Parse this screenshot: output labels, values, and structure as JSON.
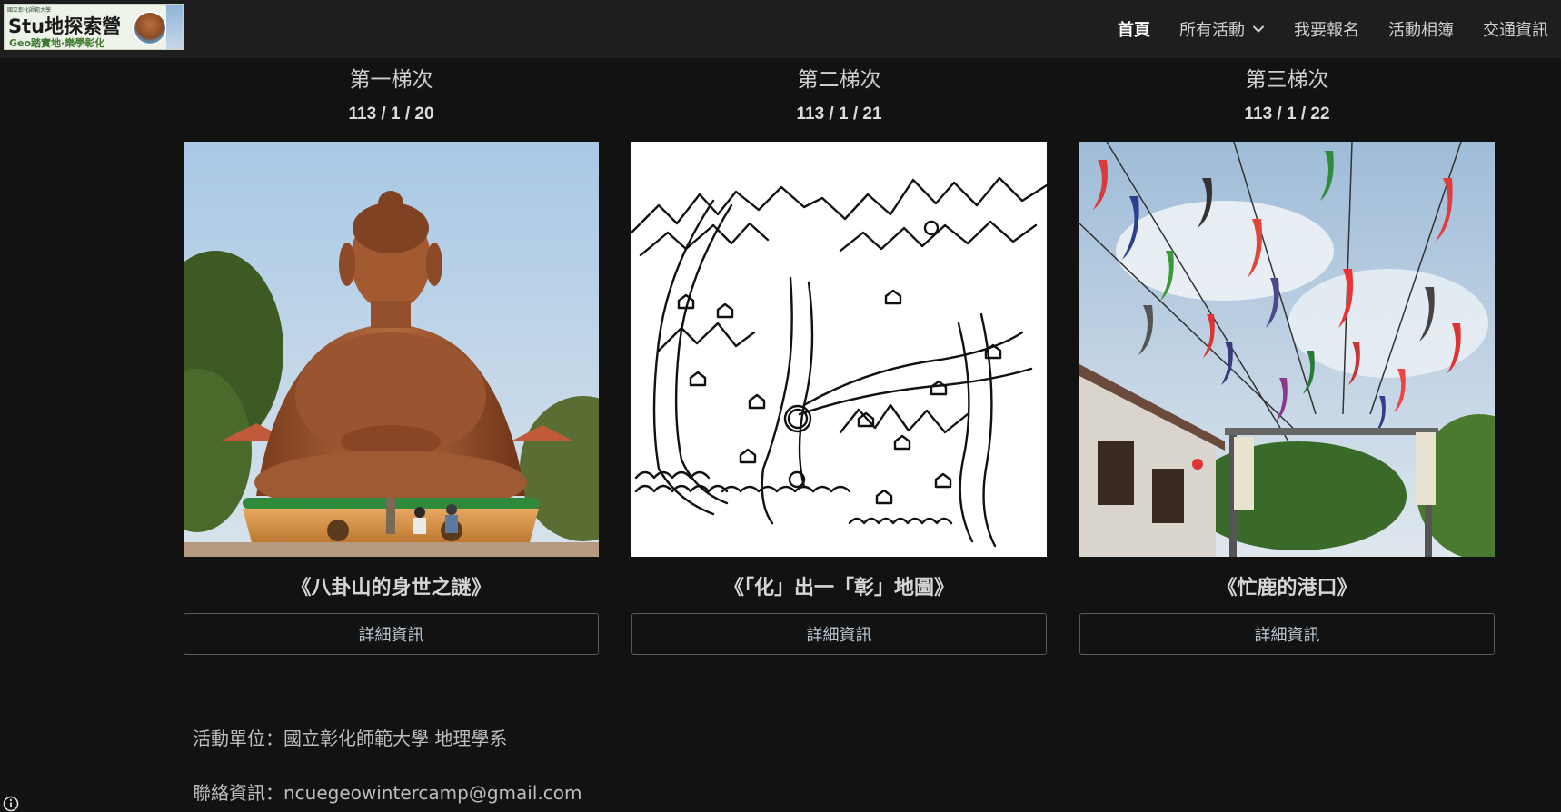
{
  "header": {
    "logo": {
      "small_text": "國立彰化師範大學",
      "main_text": "Stu地探索營",
      "sub_text": "Geo踏實地·樂學彰化"
    },
    "nav": [
      {
        "label": "首頁",
        "active": true
      },
      {
        "label": "所有活動",
        "has_dropdown": true
      },
      {
        "label": "我要報名"
      },
      {
        "label": "活動相簿"
      },
      {
        "label": "交通資訊"
      }
    ]
  },
  "sessions": [
    {
      "heading": "第一梯次",
      "date": "113 / 1 / 20",
      "image": "buddha-statue-photo",
      "title": "《八卦山的身世之謎》",
      "button_label": "詳細資訊"
    },
    {
      "heading": "第二梯次",
      "date": "113 / 1 / 21",
      "image": "hand-drawn-map",
      "title": "《「化」出一「彰」地圖》",
      "button_label": "詳細資訊"
    },
    {
      "heading": "第三梯次",
      "date": "113 / 1 / 22",
      "image": "carp-streamers-photo",
      "title": "《忙鹿的港口》",
      "button_label": "詳細資訊"
    }
  ],
  "footer": {
    "organizer": "活動單位：國立彰化師範大學 地理學系",
    "contact": "聯絡資訊：ncuegeowintercamp@gmail.com"
  },
  "icons": {
    "dropdown": "chevron-down-icon",
    "info": "info-icon"
  },
  "colors": {
    "background": "#121212",
    "header": "#1e1e1e",
    "button_border": "#5a5a5a",
    "logo_green": "#3e7a2c"
  }
}
